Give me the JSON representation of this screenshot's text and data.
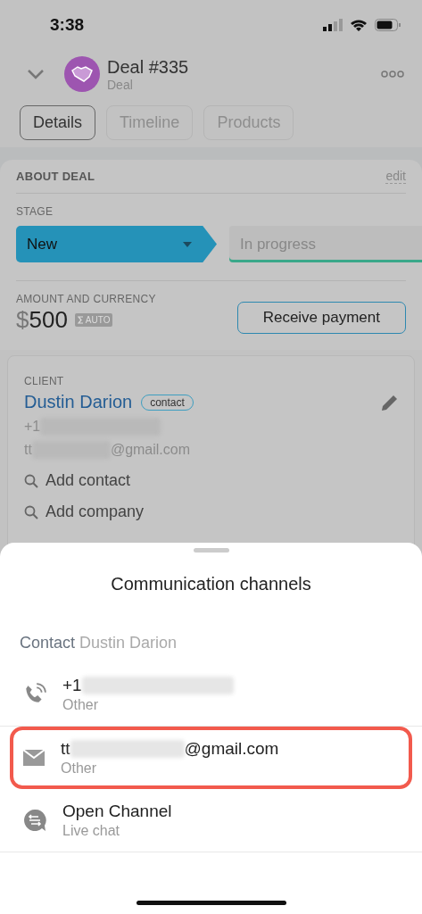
{
  "status_bar": {
    "time": "3:38"
  },
  "header": {
    "title": "Deal #335",
    "subtitle": "Deal"
  },
  "tabs": [
    {
      "label": "Details",
      "selected": true
    },
    {
      "label": "Timeline",
      "selected": false
    },
    {
      "label": "Products",
      "selected": false
    }
  ],
  "about": {
    "title": "ABOUT DEAL",
    "edit": "edit",
    "stage_label": "STAGE",
    "stages": [
      {
        "label": "New",
        "selected": true,
        "color": "#2592b8"
      },
      {
        "label": "In progress",
        "selected": false,
        "color": "#3aa88a"
      }
    ],
    "amount_label": "AMOUNT AND CURRENCY",
    "currency": "$",
    "amount": "500",
    "auto_badge": "AUTO",
    "payment_button": "Receive payment"
  },
  "client": {
    "label": "CLIENT",
    "name": "Dustin Darion",
    "badge": "contact",
    "phone_prefix": "+1",
    "email_prefix": "tt",
    "email_suffix": "@gmail.com",
    "actions": [
      "Add contact",
      "Add company"
    ]
  },
  "sheet": {
    "title": "Communication channels",
    "contact_label": "Contact",
    "contact_name": "Dustin Darion",
    "channels": [
      {
        "kind": "phone",
        "prefix": "+1",
        "type": "Other",
        "highlighted": false,
        "redacted": true
      },
      {
        "kind": "email",
        "prefix": "tt",
        "suffix": "@gmail.com",
        "type": "Other",
        "highlighted": true,
        "redacted": true
      },
      {
        "kind": "chat",
        "prefix": "Open Channel",
        "type": "Live chat",
        "highlighted": false,
        "redacted": false
      }
    ]
  }
}
